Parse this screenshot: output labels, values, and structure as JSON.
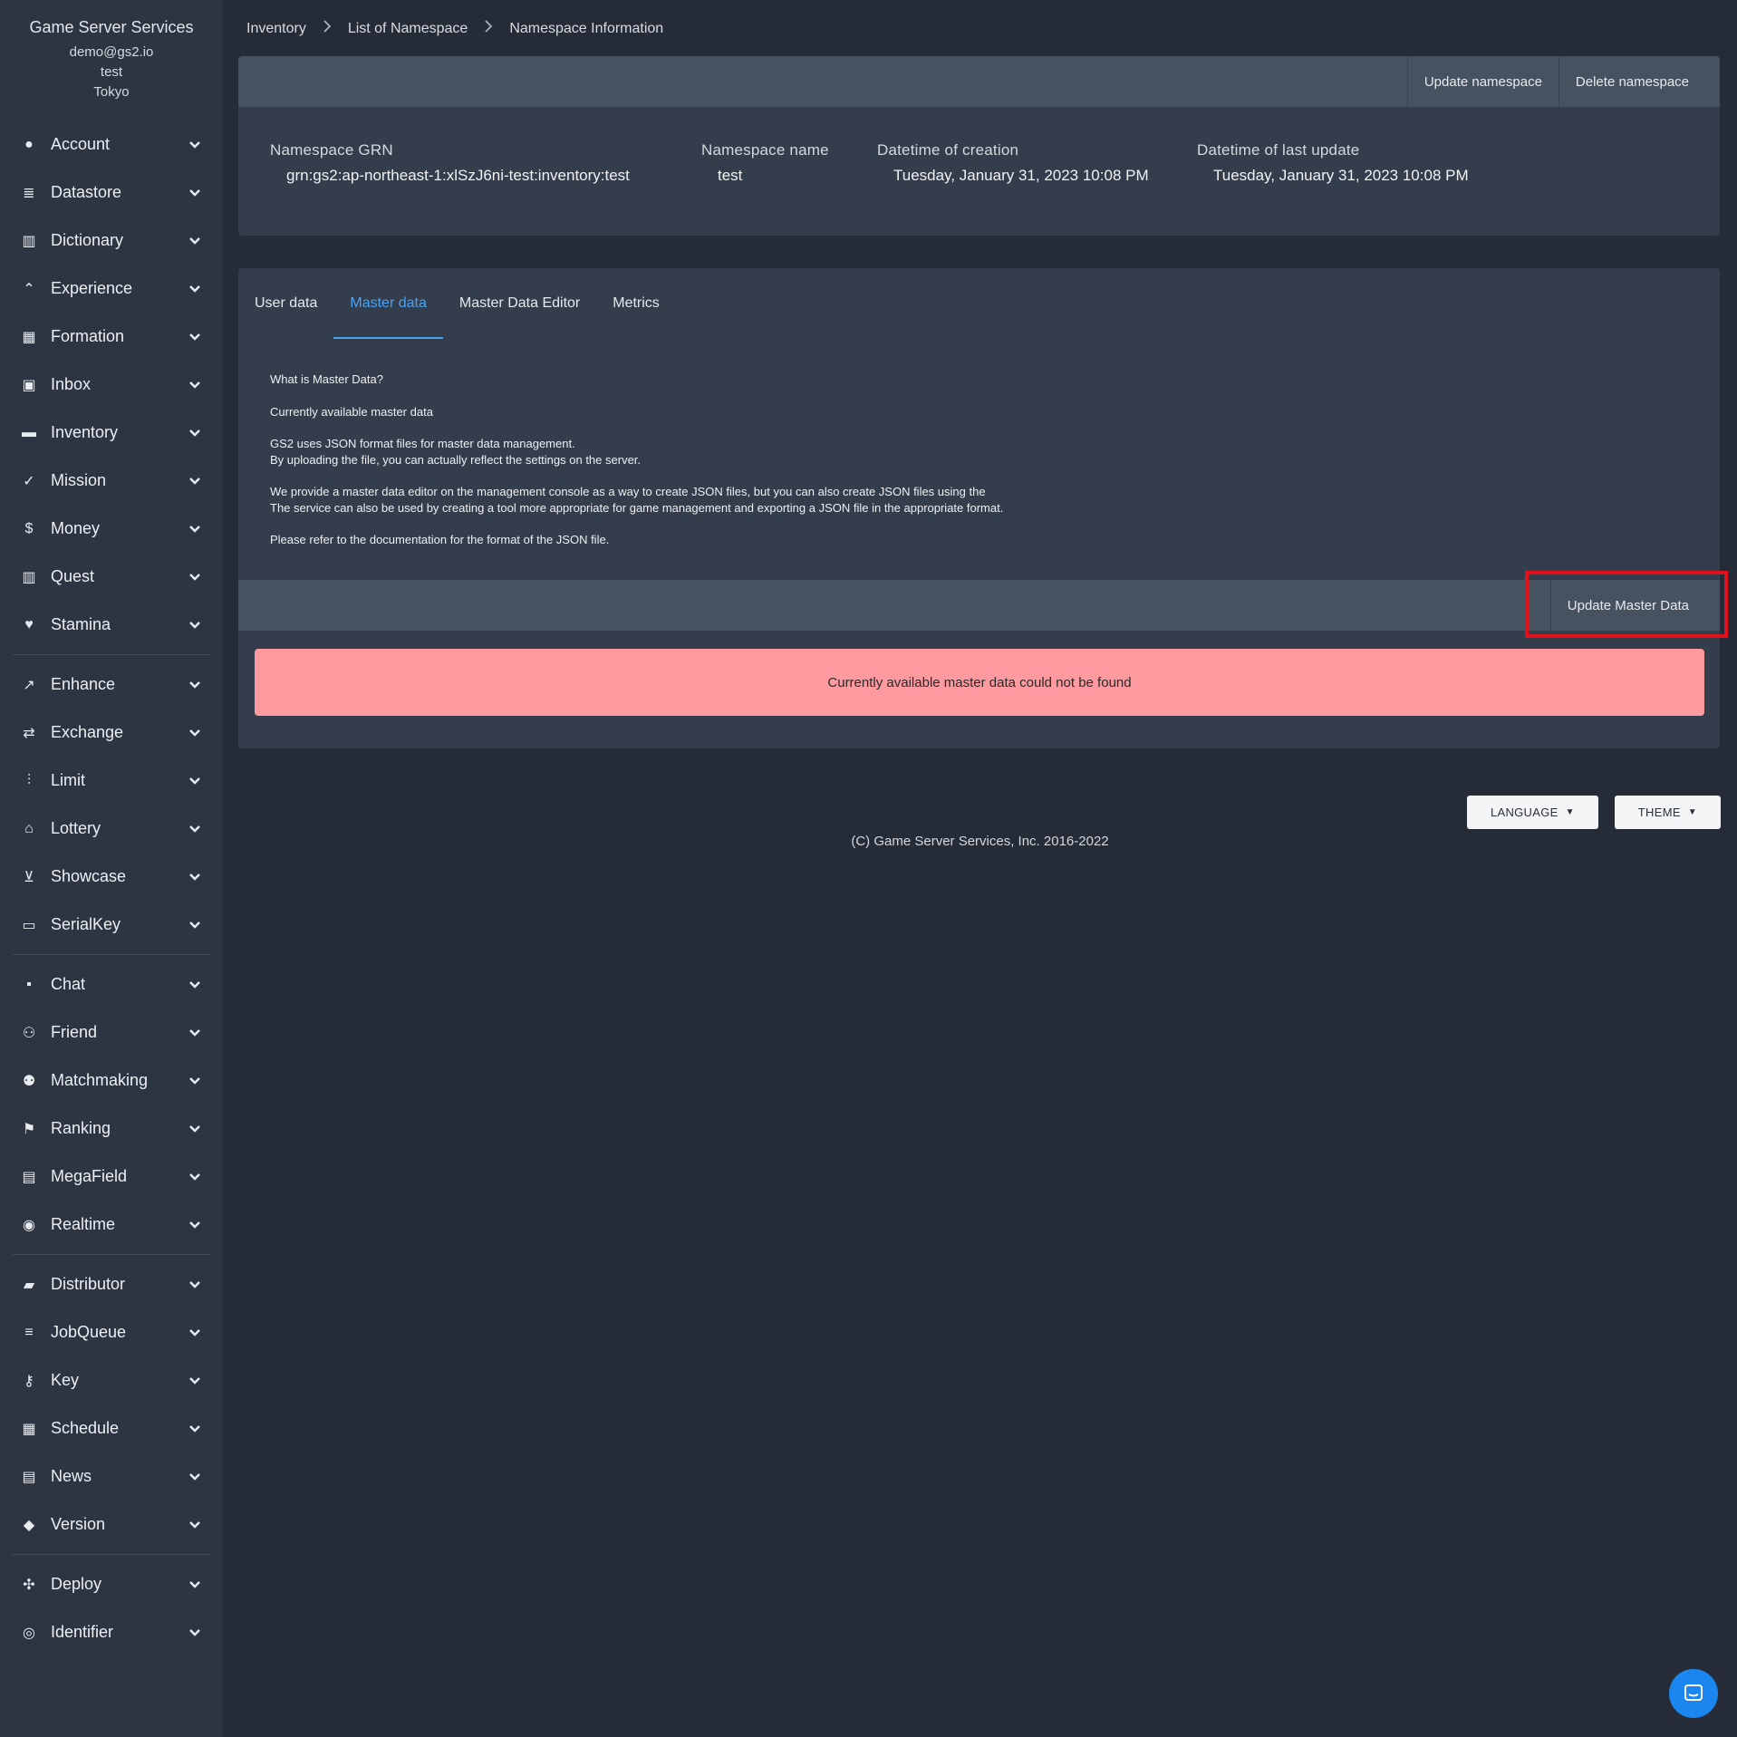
{
  "sidebar": {
    "app_name": "Game Server Services",
    "user_email": "demo@gs2.io",
    "project": "test",
    "region": "Tokyo",
    "groups": [
      {
        "items": [
          {
            "label": "Account",
            "icon": "user-circle-icon"
          },
          {
            "label": "Datastore",
            "icon": "database-icon"
          },
          {
            "label": "Dictionary",
            "icon": "book-open-icon"
          },
          {
            "label": "Experience",
            "icon": "double-chevron-up-icon"
          },
          {
            "label": "Formation",
            "icon": "grid-icon"
          },
          {
            "label": "Inbox",
            "icon": "gift-icon"
          },
          {
            "label": "Inventory",
            "icon": "briefcase-icon"
          },
          {
            "label": "Mission",
            "icon": "clipboard-check-icon"
          },
          {
            "label": "Money",
            "icon": "dollar-circle-icon"
          },
          {
            "label": "Quest",
            "icon": "book-map-icon"
          },
          {
            "label": "Stamina",
            "icon": "heart-icon"
          }
        ]
      },
      {
        "items": [
          {
            "label": "Enhance",
            "icon": "trend-up-icon"
          },
          {
            "label": "Exchange",
            "icon": "exchange-icon"
          },
          {
            "label": "Limit",
            "icon": "sliders-icon"
          },
          {
            "label": "Lottery",
            "icon": "bank-icon"
          },
          {
            "label": "Showcase",
            "icon": "cart-icon"
          },
          {
            "label": "SerialKey",
            "icon": "ticket-icon"
          }
        ]
      },
      {
        "items": [
          {
            "label": "Chat",
            "icon": "chat-icon"
          },
          {
            "label": "Friend",
            "icon": "users-icon"
          },
          {
            "label": "Matchmaking",
            "icon": "user-group-icon"
          },
          {
            "label": "Ranking",
            "icon": "flag-icon"
          },
          {
            "label": "MegaField",
            "icon": "map-icon"
          },
          {
            "label": "Realtime",
            "icon": "broadcast-icon"
          }
        ]
      },
      {
        "items": [
          {
            "label": "Distributor",
            "icon": "truck-icon"
          },
          {
            "label": "JobQueue",
            "icon": "layers-icon"
          },
          {
            "label": "Key",
            "icon": "key-icon"
          },
          {
            "label": "Schedule",
            "icon": "calendar-icon"
          },
          {
            "label": "News",
            "icon": "newspaper-icon"
          },
          {
            "label": "Version",
            "icon": "tag-icon"
          }
        ]
      },
      {
        "items": [
          {
            "label": "Deploy",
            "icon": "deploy-icon"
          },
          {
            "label": "Identifier",
            "icon": "fingerprint-icon"
          }
        ]
      }
    ]
  },
  "breadcrumb": [
    "Inventory",
    "List of Namespace",
    "Namespace Information"
  ],
  "namespace_card": {
    "buttons": {
      "update": "Update namespace",
      "delete": "Delete namespace"
    },
    "fields": [
      {
        "label": "Namespace GRN",
        "value": "grn:gs2:ap-northeast-1:xlSzJ6ni-test:inventory:test"
      },
      {
        "label": "Namespace name",
        "value": "test"
      },
      {
        "label": "Datetime of creation",
        "value": "Tuesday, January 31, 2023 10:08 PM"
      },
      {
        "label": "Datetime of last update",
        "value": "Tuesday, January 31, 2023 10:08 PM"
      }
    ]
  },
  "tabs": {
    "items": [
      "User data",
      "Master data",
      "Master Data Editor",
      "Metrics"
    ],
    "active": "Master data"
  },
  "master_data": {
    "heading": "What is Master Data?",
    "available_label": "Currently available master data",
    "para1_line1": "GS2 uses JSON format files for master data management.",
    "para1_line2": "By uploading the file, you can actually reflect the settings on the server.",
    "para2_line1": "We provide a master data editor on the management console as a way to create JSON files, but you can also create JSON files using the",
    "para2_line2": "The service can also be used by creating a tool more appropriate for game management and exporting a JSON file in the appropriate format.",
    "para3": "Please refer to the documentation for the format of the JSON file.",
    "update_button": "Update Master Data",
    "alert": "Currently available master data could not be found"
  },
  "footer": {
    "language": "LANGUAGE",
    "theme": "THEME",
    "copyright": "(C) Game Server Services, Inc. 2016-2022"
  },
  "colors": {
    "background": "#262c37",
    "sidebar": "#2e3542",
    "card": "#343d4b",
    "toolbar": "#46525f",
    "accent": "#4aa3f2",
    "alert": "#fd9aa0",
    "highlight": "#e3101c",
    "chat_button": "#1b86f0"
  }
}
